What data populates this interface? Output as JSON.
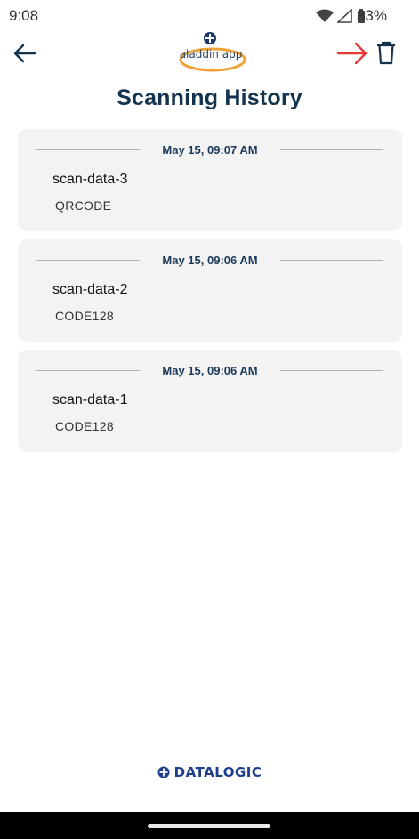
{
  "status_bar": {
    "time": "9:08",
    "battery": "83%",
    "icons": [
      "wifi-icon",
      "signal-icon",
      "battery-icon"
    ]
  },
  "app_bar": {
    "back_icon": "arrow-left-icon",
    "logo_text": "aladdin app",
    "annotation_arrow": "red-arrow-right-icon",
    "delete_icon": "trash-icon"
  },
  "page": {
    "title": "Scanning History"
  },
  "scans": [
    {
      "date": "May 15, 09:07 AM",
      "name": "scan-data-3",
      "type": "QRCODE"
    },
    {
      "date": "May 15, 09:06 AM",
      "name": "scan-data-2",
      "type": "CODE128"
    },
    {
      "date": "May 15, 09:06 AM",
      "name": "scan-data-1",
      "type": "CODE128"
    }
  ],
  "footer": {
    "brand": "DATALOGIC"
  },
  "colors": {
    "primary": "#13334f",
    "card_bg": "#f3f3f3",
    "accent_orange": "#f0a23a",
    "annotation_red": "#e53935",
    "brand_blue": "#1e3f8c"
  }
}
